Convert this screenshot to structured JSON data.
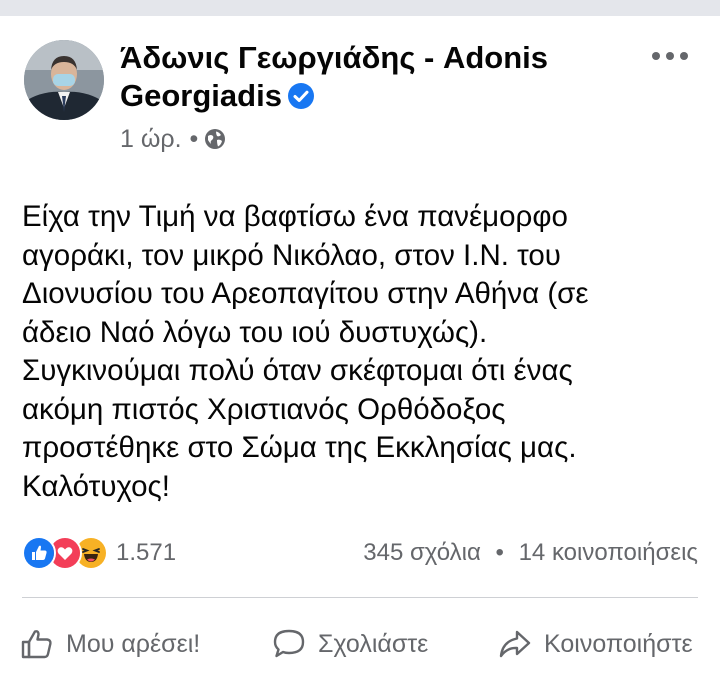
{
  "post": {
    "author": "Άδωνις Γεωργιάδης - Adonis Georgiadis",
    "time": "1 ώρ.",
    "separator": "•",
    "text": "Είχα την Τιμή να βαφτίσω ένα πανέμορφο\nαγοράκι, τον μικρό Νικόλαο, στον Ι.Ν. του\nΔιονυσίου του Αρεοπαγίτου στην Αθήνα (σε\nάδειο Ναό λόγω του ιού δυστυχώς).\nΣυγκινούμαι πολύ όταν σκέφτομαι ότι ένας\nακόμη πιστός Χριστιανός Ορθόδοξος\nπροστέθηκε στο Σώμα της Εκκλησίας μας.\nΚαλότυχος!"
  },
  "stats": {
    "reactions_count": "1.571",
    "comments": "345 σχόλια",
    "separator": "•",
    "shares": "14 κοινοποιήσεις"
  },
  "actions": {
    "like": "Μου αρέσει!",
    "comment": "Σχολιάστε",
    "share": "Κοινοποιήστε"
  },
  "icons": {
    "verified": "verified-badge-icon",
    "audience": "globe-icon",
    "more": "more-options-icon",
    "reactions": [
      "like-reaction-icon",
      "love-reaction-icon",
      "haha-reaction-icon"
    ]
  },
  "colors": {
    "verified_blue": "#1877f2",
    "love_red": "#f33e58",
    "haha_yellow": "#f7b125",
    "text": "#050505",
    "secondary_text": "#65676b"
  }
}
